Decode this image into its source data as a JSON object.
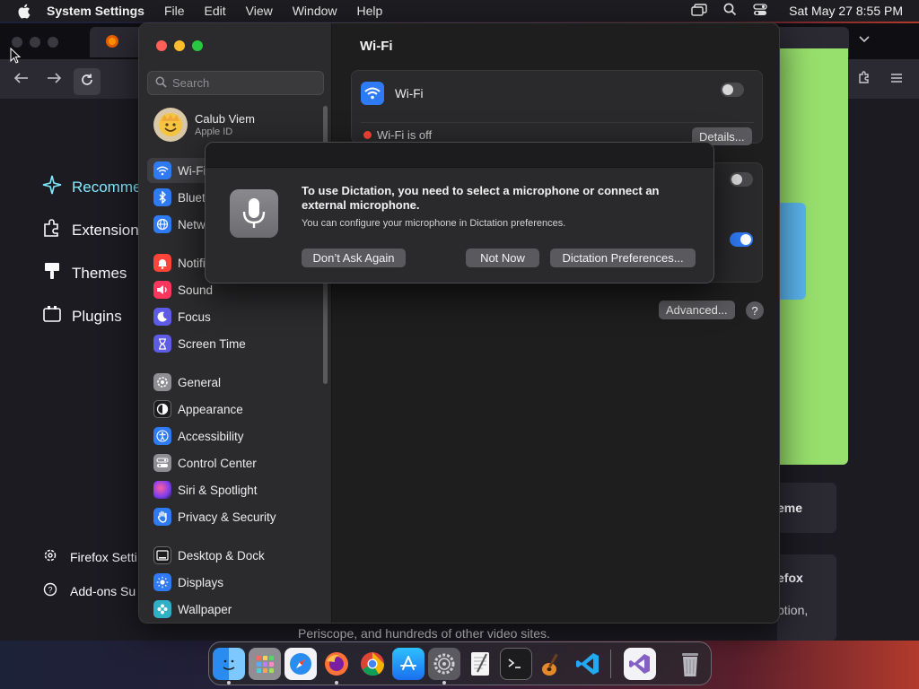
{
  "menubar": {
    "app_name": "System Settings",
    "items": [
      "File",
      "Edit",
      "View",
      "Window",
      "Help"
    ],
    "clock": "Sat May 27  8:55 PM"
  },
  "firefox": {
    "sidebar": {
      "recommended": "Recomme",
      "extensions": "Extensions",
      "themes": "Themes",
      "plugins": "Plugins"
    },
    "footer": {
      "settings": "Firefox Setti",
      "addons_support": "Add-ons Su"
    },
    "card_theme": "eme",
    "card_firefox": "efox",
    "card_option": "ption,",
    "periscope_text": "Periscope, and hundreds of other video sites."
  },
  "settings": {
    "search_placeholder": "Search",
    "profile": {
      "name": "Calub Viem",
      "subtitle": "Apple ID"
    },
    "sidebar_items": [
      {
        "label": "Wi-Fi",
        "icon": "wifi-icon",
        "color": "#2f7bf5"
      },
      {
        "label": "Blueto",
        "icon": "bluetooth-icon",
        "color": "#2f7bf5"
      },
      {
        "label": "Netwo",
        "icon": "globe-icon",
        "color": "#2f7bf5"
      },
      {
        "label": "Notifi",
        "icon": "bell-icon",
        "color": "#ff453a"
      },
      {
        "label": "Sound",
        "icon": "speaker-icon",
        "color": "#ff375f"
      },
      {
        "label": "Focus",
        "icon": "moon-icon",
        "color": "#5e5ce6"
      },
      {
        "label": "Screen Time",
        "icon": "hourglass-icon",
        "color": "#5e5ce6"
      },
      {
        "label": "General",
        "icon": "gear-icon",
        "color": "#8e8e93"
      },
      {
        "label": "Appearance",
        "icon": "appearance-icon",
        "color": "#1c1c1e"
      },
      {
        "label": "Accessibility",
        "icon": "accessibility-icon",
        "color": "#2f7bf5"
      },
      {
        "label": "Control Center",
        "icon": "control-center-icon",
        "color": "#8e8e93"
      },
      {
        "label": "Siri & Spotlight",
        "icon": "siri-icon",
        "color": "#bf5af2"
      },
      {
        "label": "Privacy & Security",
        "icon": "hand-icon",
        "color": "#2f7bf5"
      },
      {
        "label": "Desktop & Dock",
        "icon": "desktop-icon",
        "color": "#1c1c1e"
      },
      {
        "label": "Displays",
        "icon": "sun-icon",
        "color": "#2f7bf5"
      },
      {
        "label": "Wallpaper",
        "icon": "wallpaper-icon",
        "color": "#30b0c7"
      }
    ],
    "title": "Wi-Fi",
    "wifi_label": "Wi-Fi",
    "wifi_status": "Wi-Fi is off",
    "details_button": "Details...",
    "advanced_button": "Advanced...",
    "help_button": "?"
  },
  "dialog": {
    "title": "To use Dictation, you need to select a microphone or connect an external microphone.",
    "message": "You can configure your microphone in Dictation preferences.",
    "buttons": {
      "dont_ask": "Don’t Ask Again",
      "not_now": "Not Now",
      "preferences": "Dictation Preferences..."
    }
  },
  "dock": {
    "apps": [
      "Finder",
      "Launchpad",
      "Safari",
      "Firefox",
      "Chrome",
      "App Store",
      "System Settings",
      "TextEdit",
      "Terminal",
      "GarageBand",
      "VS Code",
      "Visual Studio",
      "Trash"
    ]
  },
  "colors": {
    "accent": "#2f7bf5",
    "status_off": "#ff453a",
    "firefox_accent": "#80ebff"
  }
}
